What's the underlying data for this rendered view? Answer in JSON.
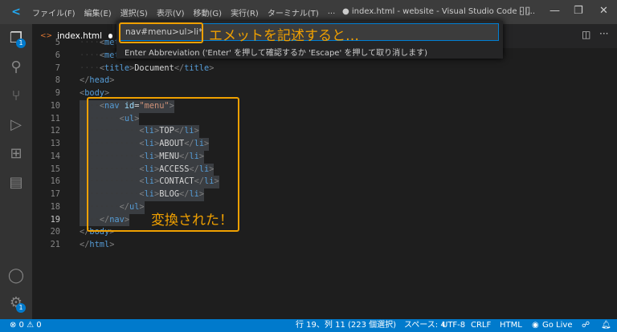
{
  "titlebar": {
    "menus": [
      "ファイル(F)",
      "編集(E)",
      "選択(S)",
      "表示(V)",
      "移動(G)",
      "実行(R)",
      "ターミナル(T)",
      "···"
    ],
    "title": "● index.html - website - Visual Studio Code - I..."
  },
  "activity": {
    "explorer_badge": "1",
    "settings_badge": "1"
  },
  "tab": {
    "label": "index.html"
  },
  "quick_input": {
    "value": "nav#menu>ul>li*",
    "hint": "Enter Abbreviation ('Enter' を押して確認するか 'Escape' を押して取り消します)"
  },
  "annotations": {
    "top": "エメットを記述すると…",
    "bottom": "変換された！"
  },
  "colors": {
    "accent": "#007acc",
    "annotation": "#f0a000"
  },
  "lines": [
    {
      "n": "5",
      "ind": "····",
      "parts": [
        [
          "t",
          "<"
        ],
        [
          "k",
          "met"
        ]
      ]
    },
    {
      "n": "6",
      "ind": "····",
      "parts": [
        [
          "t",
          "<"
        ],
        [
          "k",
          "met"
        ]
      ]
    },
    {
      "n": "7",
      "ind": "····",
      "parts": [
        [
          "t",
          "<"
        ],
        [
          "k",
          "title"
        ],
        [
          "t",
          ">"
        ],
        [
          "x",
          "Document"
        ],
        [
          "t",
          "</"
        ],
        [
          "k",
          "title"
        ],
        [
          "t",
          ">"
        ]
      ]
    },
    {
      "n": "8",
      "ind": "",
      "parts": [
        [
          "t",
          "</"
        ],
        [
          "k",
          "head"
        ],
        [
          "t",
          ">"
        ]
      ]
    },
    {
      "n": "9",
      "ind": "",
      "parts": [
        [
          "t",
          "<"
        ],
        [
          "k",
          "body"
        ],
        [
          "t",
          ">"
        ]
      ]
    },
    {
      "n": "10",
      "ind": "····",
      "sel": true,
      "parts": [
        [
          "t",
          "<"
        ],
        [
          "k",
          "nav"
        ],
        [
          "x",
          " "
        ],
        [
          "a",
          "id"
        ],
        [
          "x",
          "="
        ],
        [
          "s",
          "\"menu\""
        ],
        [
          "t",
          ">"
        ]
      ]
    },
    {
      "n": "11",
      "ind": "········",
      "sel": true,
      "parts": [
        [
          "t",
          "<"
        ],
        [
          "k",
          "ul"
        ],
        [
          "t",
          ">"
        ]
      ]
    },
    {
      "n": "12",
      "ind": "············",
      "sel": true,
      "parts": [
        [
          "t",
          "<"
        ],
        [
          "k",
          "li"
        ],
        [
          "t",
          ">"
        ],
        [
          "x",
          "TOP"
        ],
        [
          "t",
          "</"
        ],
        [
          "k",
          "li"
        ],
        [
          "t",
          ">"
        ]
      ]
    },
    {
      "n": "13",
      "ind": "············",
      "sel": true,
      "parts": [
        [
          "t",
          "<"
        ],
        [
          "k",
          "li"
        ],
        [
          "t",
          ">"
        ],
        [
          "x",
          "ABOUT"
        ],
        [
          "t",
          "</"
        ],
        [
          "k",
          "li"
        ],
        [
          "t",
          ">"
        ]
      ]
    },
    {
      "n": "14",
      "ind": "············",
      "sel": true,
      "parts": [
        [
          "t",
          "<"
        ],
        [
          "k",
          "li"
        ],
        [
          "t",
          ">"
        ],
        [
          "x",
          "MENU"
        ],
        [
          "t",
          "</"
        ],
        [
          "k",
          "li"
        ],
        [
          "t",
          ">"
        ]
      ]
    },
    {
      "n": "15",
      "ind": "············",
      "sel": true,
      "parts": [
        [
          "t",
          "<"
        ],
        [
          "k",
          "li"
        ],
        [
          "t",
          ">"
        ],
        [
          "x",
          "ACCESS"
        ],
        [
          "t",
          "</"
        ],
        [
          "k",
          "li"
        ],
        [
          "t",
          ">"
        ]
      ]
    },
    {
      "n": "16",
      "ind": "············",
      "sel": true,
      "parts": [
        [
          "t",
          "<"
        ],
        [
          "k",
          "li"
        ],
        [
          "t",
          ">"
        ],
        [
          "x",
          "CONTACT"
        ],
        [
          "t",
          "</"
        ],
        [
          "k",
          "li"
        ],
        [
          "t",
          ">"
        ]
      ]
    },
    {
      "n": "17",
      "ind": "············",
      "sel": true,
      "parts": [
        [
          "t",
          "<"
        ],
        [
          "k",
          "li"
        ],
        [
          "t",
          ">"
        ],
        [
          "x",
          "BLOG"
        ],
        [
          "t",
          "</"
        ],
        [
          "k",
          "li"
        ],
        [
          "t",
          ">"
        ]
      ]
    },
    {
      "n": "18",
      "ind": "········",
      "sel": true,
      "parts": [
        [
          "t",
          "</"
        ],
        [
          "k",
          "ul"
        ],
        [
          "t",
          ">"
        ]
      ]
    },
    {
      "n": "19",
      "ind": "····",
      "sel": true,
      "cur": true,
      "parts": [
        [
          "t",
          "</"
        ],
        [
          "k",
          "nav"
        ],
        [
          "t",
          ">"
        ]
      ]
    },
    {
      "n": "20",
      "ind": "",
      "parts": [
        [
          "t",
          "</"
        ],
        [
          "k",
          "body"
        ],
        [
          "t",
          ">"
        ]
      ]
    },
    {
      "n": "21",
      "ind": "",
      "parts": [
        [
          "t",
          "</"
        ],
        [
          "k",
          "html"
        ],
        [
          "t",
          ">"
        ]
      ]
    }
  ],
  "status": {
    "errors": "⊗ 0 ⚠ 0",
    "position": "行 19、列 11 (223 個選択)",
    "spaces": "スペース: 4",
    "encoding": "UTF-8",
    "eol": "CRLF",
    "language": "HTML",
    "golive": "Go Live"
  }
}
